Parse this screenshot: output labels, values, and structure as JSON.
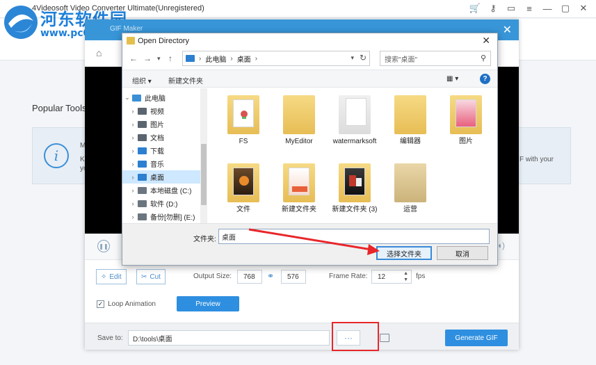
{
  "app": {
    "title": "4Videosoft Video Converter Ultimate(Unregistered)",
    "watermark_line1": "河东软件园",
    "watermark_line2": "www.pc0359.cn",
    "popular_tools": "Popular Tools",
    "info_fragments": [
      "M",
      "Ke",
      "yo",
      "F with your"
    ]
  },
  "gif_maker": {
    "title": "GIF Maker",
    "edit_label": "Edit",
    "cut_label": "Cut",
    "output_size_label": "Output Size:",
    "width": "768",
    "height": "576",
    "frame_rate_label": "Frame Rate:",
    "frame_rate": "12",
    "fps_label": "fps",
    "loop_label": "Loop Animation",
    "loop_checked": true,
    "preview_label": "Preview",
    "save_to_label": "Save to:",
    "save_path": "D:\\tools\\桌面",
    "browse_label": "···",
    "generate_label": "Generate GIF"
  },
  "open_directory": {
    "title": "Open Directory",
    "breadcrumb": [
      "此电脑",
      "桌面"
    ],
    "search_placeholder": "搜索\"桌面\"",
    "toolbar": {
      "organize": "组织 ▾",
      "new_folder": "新建文件夹"
    },
    "nav_items": [
      {
        "label": "此电脑",
        "icon": "computer-icon",
        "color": "#3b8fd6"
      },
      {
        "label": "视频",
        "icon": "video-folder-icon",
        "color": "#5a6570"
      },
      {
        "label": "图片",
        "icon": "pictures-folder-icon",
        "color": "#5a6570"
      },
      {
        "label": "文档",
        "icon": "documents-folder-icon",
        "color": "#5a6570"
      },
      {
        "label": "下载",
        "icon": "download-icon",
        "color": "#2d7fd0"
      },
      {
        "label": "音乐",
        "icon": "music-icon",
        "color": "#2d7fd0"
      },
      {
        "label": "桌面",
        "icon": "desktop-icon",
        "color": "#2d7fd0",
        "selected": true
      },
      {
        "label": "本地磁盘 (C:)",
        "icon": "drive-icon",
        "color": "#6b7680"
      },
      {
        "label": "软件 (D:)",
        "icon": "drive-icon",
        "color": "#6b7680"
      },
      {
        "label": "备份[勿删] (E:)",
        "icon": "drive-icon",
        "color": "#6b7680"
      }
    ],
    "files": [
      {
        "name": "FS",
        "kind": "doc-folder"
      },
      {
        "name": "MyEditor",
        "kind": "folder"
      },
      {
        "name": "watermarksoft",
        "kind": "paper-folder"
      },
      {
        "name": "编辑器",
        "kind": "folder"
      },
      {
        "name": "图片",
        "kind": "pink-folder"
      },
      {
        "name": "文件",
        "kind": "dark-folder"
      },
      {
        "name": "新建文件夹",
        "kind": "pdf-folder"
      },
      {
        "name": "新建文件夹 (3)",
        "kind": "photo-folder"
      },
      {
        "name": "运营",
        "kind": "folder"
      }
    ],
    "folder_label": "文件夹:",
    "folder_value": "桌面",
    "select_label": "选择文件夹",
    "cancel_label": "取消"
  },
  "colors": {
    "accent": "#2e8fe0",
    "header": "#3896d8",
    "annotation": "#e8262a"
  }
}
